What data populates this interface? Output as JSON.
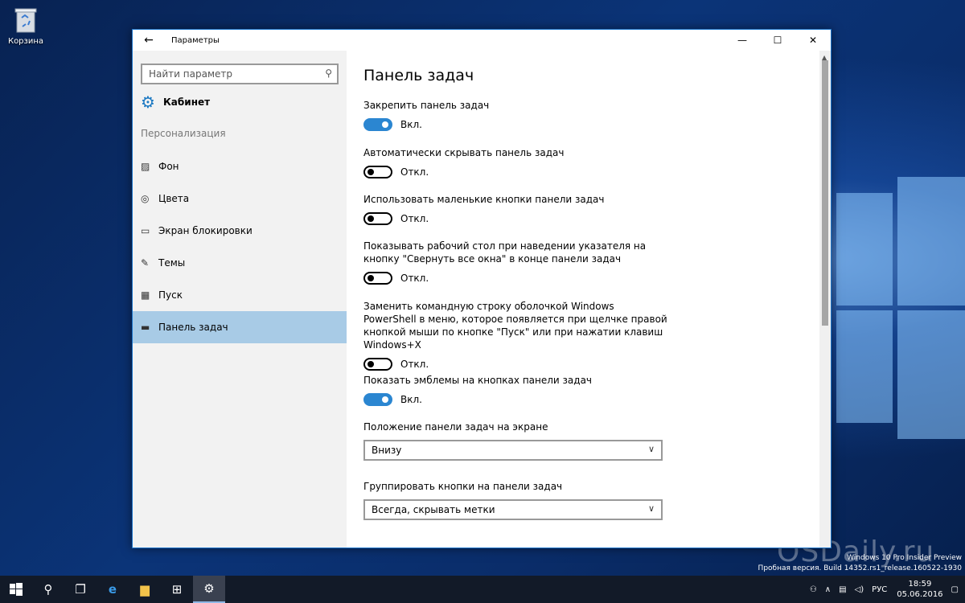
{
  "desktop": {
    "recycle_label": "Корзина",
    "watermark_line1": "Windows 10 Pro Insider Preview",
    "watermark_line2": "Пробная версия. Build 14352.rs1_release.160522-1930",
    "site": "OSDaily.ru"
  },
  "window": {
    "title": "Параметры",
    "back_icon": "arrow-left",
    "minimize": "—",
    "maximize": "☐",
    "close": "✕"
  },
  "sidebar": {
    "search_placeholder": "Найти параметр",
    "home_label": "Кабинет",
    "section_label": "Персонализация",
    "items": [
      {
        "label": "Фон",
        "icon": "image-icon"
      },
      {
        "label": "Цвета",
        "icon": "palette-icon"
      },
      {
        "label": "Экран блокировки",
        "icon": "lockscreen-icon"
      },
      {
        "label": "Темы",
        "icon": "themes-icon"
      },
      {
        "label": "Пуск",
        "icon": "start-icon"
      },
      {
        "label": "Панель задач",
        "icon": "taskbar-icon"
      }
    ],
    "active_index": 5
  },
  "main": {
    "title": "Панель задач",
    "settings": [
      {
        "label": "Закрепить панель задач",
        "on": true,
        "state": "Вкл."
      },
      {
        "label": "Автоматически скрывать панель задач",
        "on": false,
        "state": "Откл."
      },
      {
        "label": "Использовать маленькие кнопки панели задач",
        "on": false,
        "state": "Откл."
      },
      {
        "label": "Показывать рабочий стол при наведении указателя на кнопку \"Свернуть все окна\" в конце панели задач",
        "on": false,
        "state": "Откл."
      },
      {
        "label": "Заменить командную строку оболочкой Windows PowerShell в меню, которое появляется при щелчке правой кнопкой мыши по кнопке \"Пуск\" или при нажатии клавиш Windows+X",
        "on": false,
        "state": "Откл."
      },
      {
        "label": "Показать эмблемы на кнопках панели задач",
        "on": true,
        "state": "Вкл."
      }
    ],
    "position_label": "Положение панели задач на экране",
    "position_value": "Внизу",
    "group_label": "Группировать кнопки на панели задач",
    "group_value": "Всегда, скрывать метки"
  },
  "taskbar": {
    "lang": "РУС",
    "time": "18:59",
    "date": "05.06.2016"
  },
  "colors": {
    "accent": "#2b86d1",
    "active_nav": "#a8cbe6"
  }
}
